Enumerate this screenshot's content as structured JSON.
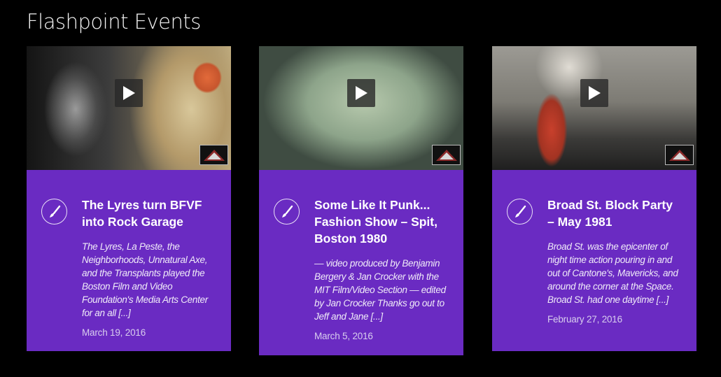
{
  "section": {
    "title": "Flashpoint Events"
  },
  "icons": {
    "play": "play-icon",
    "category": "paintbrush-icon",
    "channel": "flashpoint-logo-icon"
  },
  "colors": {
    "card_bg": "#6a2bc2",
    "page_bg": "#000000"
  },
  "cards": [
    {
      "title": "The Lyres turn BFVF into Rock Garage",
      "excerpt": "The Lyres, La Peste, the Neighborhoods, Unnatural Axe, and the Transplants played the Boston Film and Video Foundation's Media Arts Center for an all [...]",
      "date": "March 19, 2016"
    },
    {
      "title": "Some Like It Punk... Fashion Show – Spit, Boston 1980",
      "excerpt": "— video produced by Benjamin Bergery & Jan Crocker with the MIT Film/Video Section — edited by Jan Crocker Thanks go out to Jeff and Jane [...]",
      "date": "March 5, 2016"
    },
    {
      "title": "Broad St. Block Party – May 1981",
      "excerpt": "Broad St. was the epicenter of night time action pouring in and out of Cantone's, Mavericks, and around the corner at the Space. Broad St. had one daytime [...]",
      "date": "February 27, 2016"
    }
  ]
}
